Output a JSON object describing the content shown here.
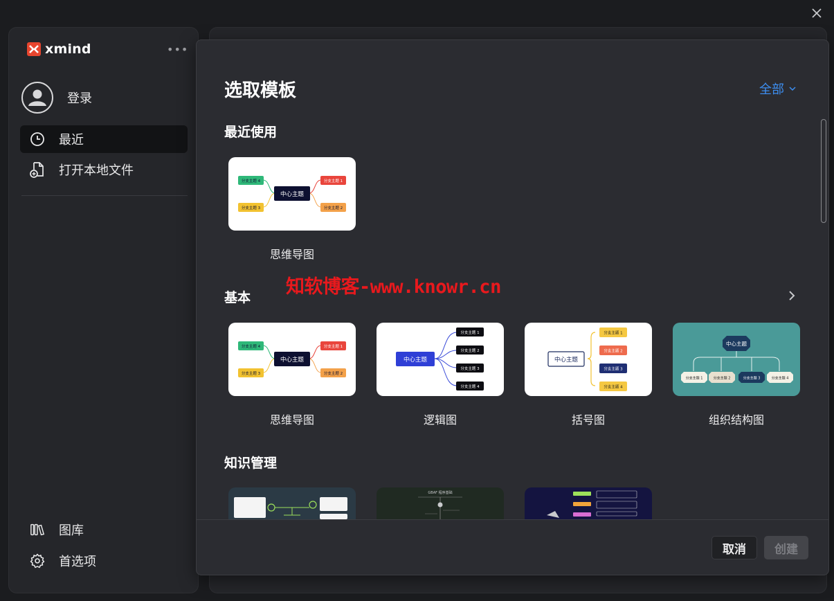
{
  "brand": {
    "name": "xmind",
    "more": "•••"
  },
  "sidebar": {
    "login_label": "登录",
    "items": [
      {
        "label": "最近",
        "icon": "clock-icon",
        "active": true
      },
      {
        "label": "打开本地文件",
        "icon": "file-add-icon",
        "active": false
      }
    ],
    "bottom_items": [
      {
        "label": "图库",
        "icon": "library-icon"
      },
      {
        "label": "首选项",
        "icon": "gear-icon"
      }
    ]
  },
  "modal": {
    "title": "选取模板",
    "filter_label": "全部",
    "sections": {
      "recent": {
        "title": "最近使用",
        "cards": [
          {
            "label": "思维导图"
          }
        ]
      },
      "basic": {
        "title": "基本",
        "cards": [
          {
            "label": "思维导图"
          },
          {
            "label": "逻辑图"
          },
          {
            "label": "括号图"
          },
          {
            "label": "组织结构图"
          }
        ]
      },
      "knowledge": {
        "title": "知识管理"
      }
    },
    "cancel_label": "取消",
    "create_label": "创建"
  },
  "thumbs": {
    "center": "中心主题",
    "branch1": "分支主题 1",
    "branch2": "分支主题 2",
    "branch3": "分支主题 3",
    "branch4": "分支主题 4",
    "gbaf": "GBAF 程序基础"
  },
  "watermark": "知软博客-www.knowr.cn",
  "colors": {
    "accent": "#3d8ef0",
    "watermark": "#e8191d",
    "org_bg": "#4a9a98"
  }
}
